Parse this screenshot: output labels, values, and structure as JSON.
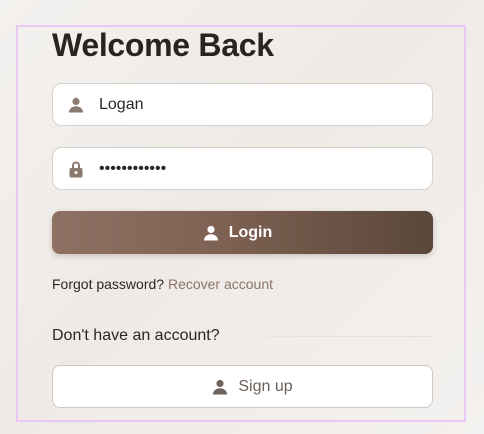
{
  "login_form": {
    "title": "Welcome Back",
    "username": {
      "value": "Logan",
      "icon": "user-icon"
    },
    "password": {
      "value": "••••••••••••",
      "icon": "lock-icon"
    },
    "login_button": {
      "label": "Login",
      "icon": "user-icon"
    },
    "forgot_text": "Forgot password?",
    "recover_link": "Recover account",
    "signup_prompt": "Don't have an account?",
    "signup_button": {
      "label": "Sign up",
      "icon": "user-icon"
    }
  },
  "colors": {
    "accent": "#7d6152",
    "link": "#8c7468",
    "frame": "#e8c8f3"
  }
}
